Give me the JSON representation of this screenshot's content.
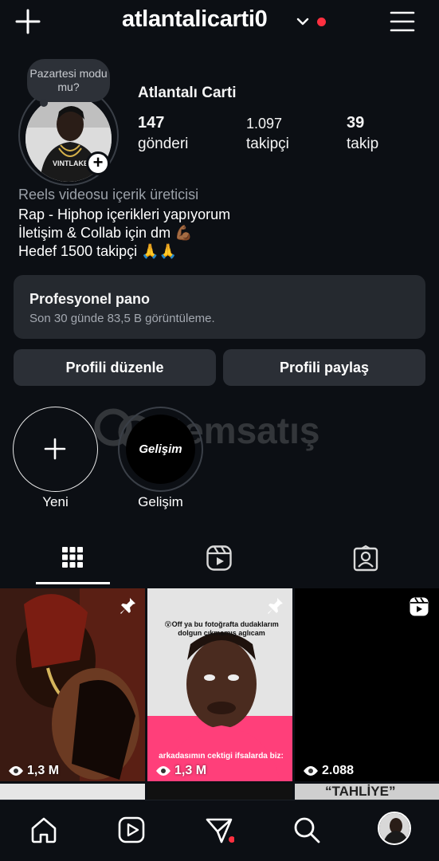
{
  "header": {
    "username": "atlantalicarti0",
    "create_icon": "plus-icon",
    "menu_icon": "hamburger-menu-icon"
  },
  "profile": {
    "note": "Pazartesi modu mu?",
    "display_name": "Atlantalı Carti",
    "stats": [
      {
        "value": "147",
        "label": "gönderi"
      },
      {
        "value": "1.097",
        "label": "takipçi"
      },
      {
        "value": "39",
        "label": "takip"
      }
    ],
    "category": "Reels videosu içerik üreticisi",
    "bio": [
      "Rap - Hiphop içerikleri yapıyorum",
      "İletişim & Collab için dm 💪🏾",
      "Hedef 1500 takipçi 🙏🙏"
    ]
  },
  "dashboard": {
    "title": "Profesyonel pano",
    "subtitle": "Son 30 günde 83,5 B görüntüleme."
  },
  "actions": {
    "edit": "Profili düzenle",
    "share": "Profili paylaş"
  },
  "highlights": [
    {
      "label": "Yeni",
      "cover_text": "+"
    },
    {
      "label": "Gelişim",
      "cover_text": "Gelişim"
    }
  ],
  "watermark": "itemsatış",
  "tabs": [
    "grid-icon",
    "reels-icon",
    "tagged-icon"
  ],
  "posts": [
    {
      "views": "1,3 M",
      "pinned": true
    },
    {
      "views": "1,3 M",
      "pinned": true,
      "caption_top": "😵Off ya bu fotoğrafta dudaklarım dolgun çıkmamış aglıcam",
      "caption_bottom": "arkadasımın cektigi ifsalarda biz:"
    },
    {
      "views": "2.088",
      "pinned": false,
      "reel": true
    }
  ],
  "next_row_caption": "“TAHLİYE”",
  "bottom_nav": [
    "home-icon",
    "reels-icon",
    "messages-icon",
    "search-icon",
    "profile-avatar"
  ],
  "colors": {
    "background": "#0c0f14",
    "card": "#25292f",
    "button": "#2b2f36",
    "notification": "#ff3040",
    "tile_pink": "#ff3f7a"
  }
}
